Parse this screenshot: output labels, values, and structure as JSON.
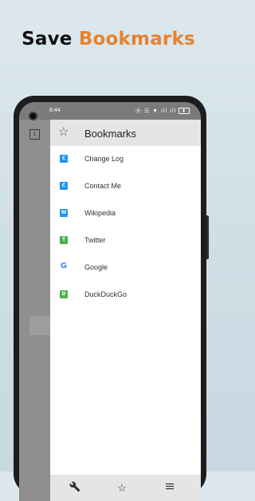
{
  "promo": {
    "title_part1": "Save ",
    "title_part2": "Bookmarks",
    "accent_color": "#e8812d"
  },
  "statusbar": {
    "time": "8:44"
  },
  "background": {
    "tabs_count": "1"
  },
  "drawer": {
    "title": "Bookmarks",
    "items": [
      {
        "label": "Change Log",
        "favicon": "C",
        "color": "#2196f3"
      },
      {
        "label": "Contact Me",
        "favicon": "C",
        "color": "#2196f3"
      },
      {
        "label": "Wikipedia",
        "favicon": "W",
        "color": "#2196f3"
      },
      {
        "label": "Twitter",
        "favicon": "T",
        "color": "#4caf50"
      },
      {
        "label": "Google",
        "favicon": "G",
        "color": "#4285f4"
      },
      {
        "label": "DuckDuckGo",
        "favicon": "D",
        "color": "#4caf50"
      }
    ],
    "toolbar": {
      "tools_icon": "wrench-icon",
      "bookmarks_icon": "star-icon",
      "menu_icon": "menu-icon"
    }
  }
}
